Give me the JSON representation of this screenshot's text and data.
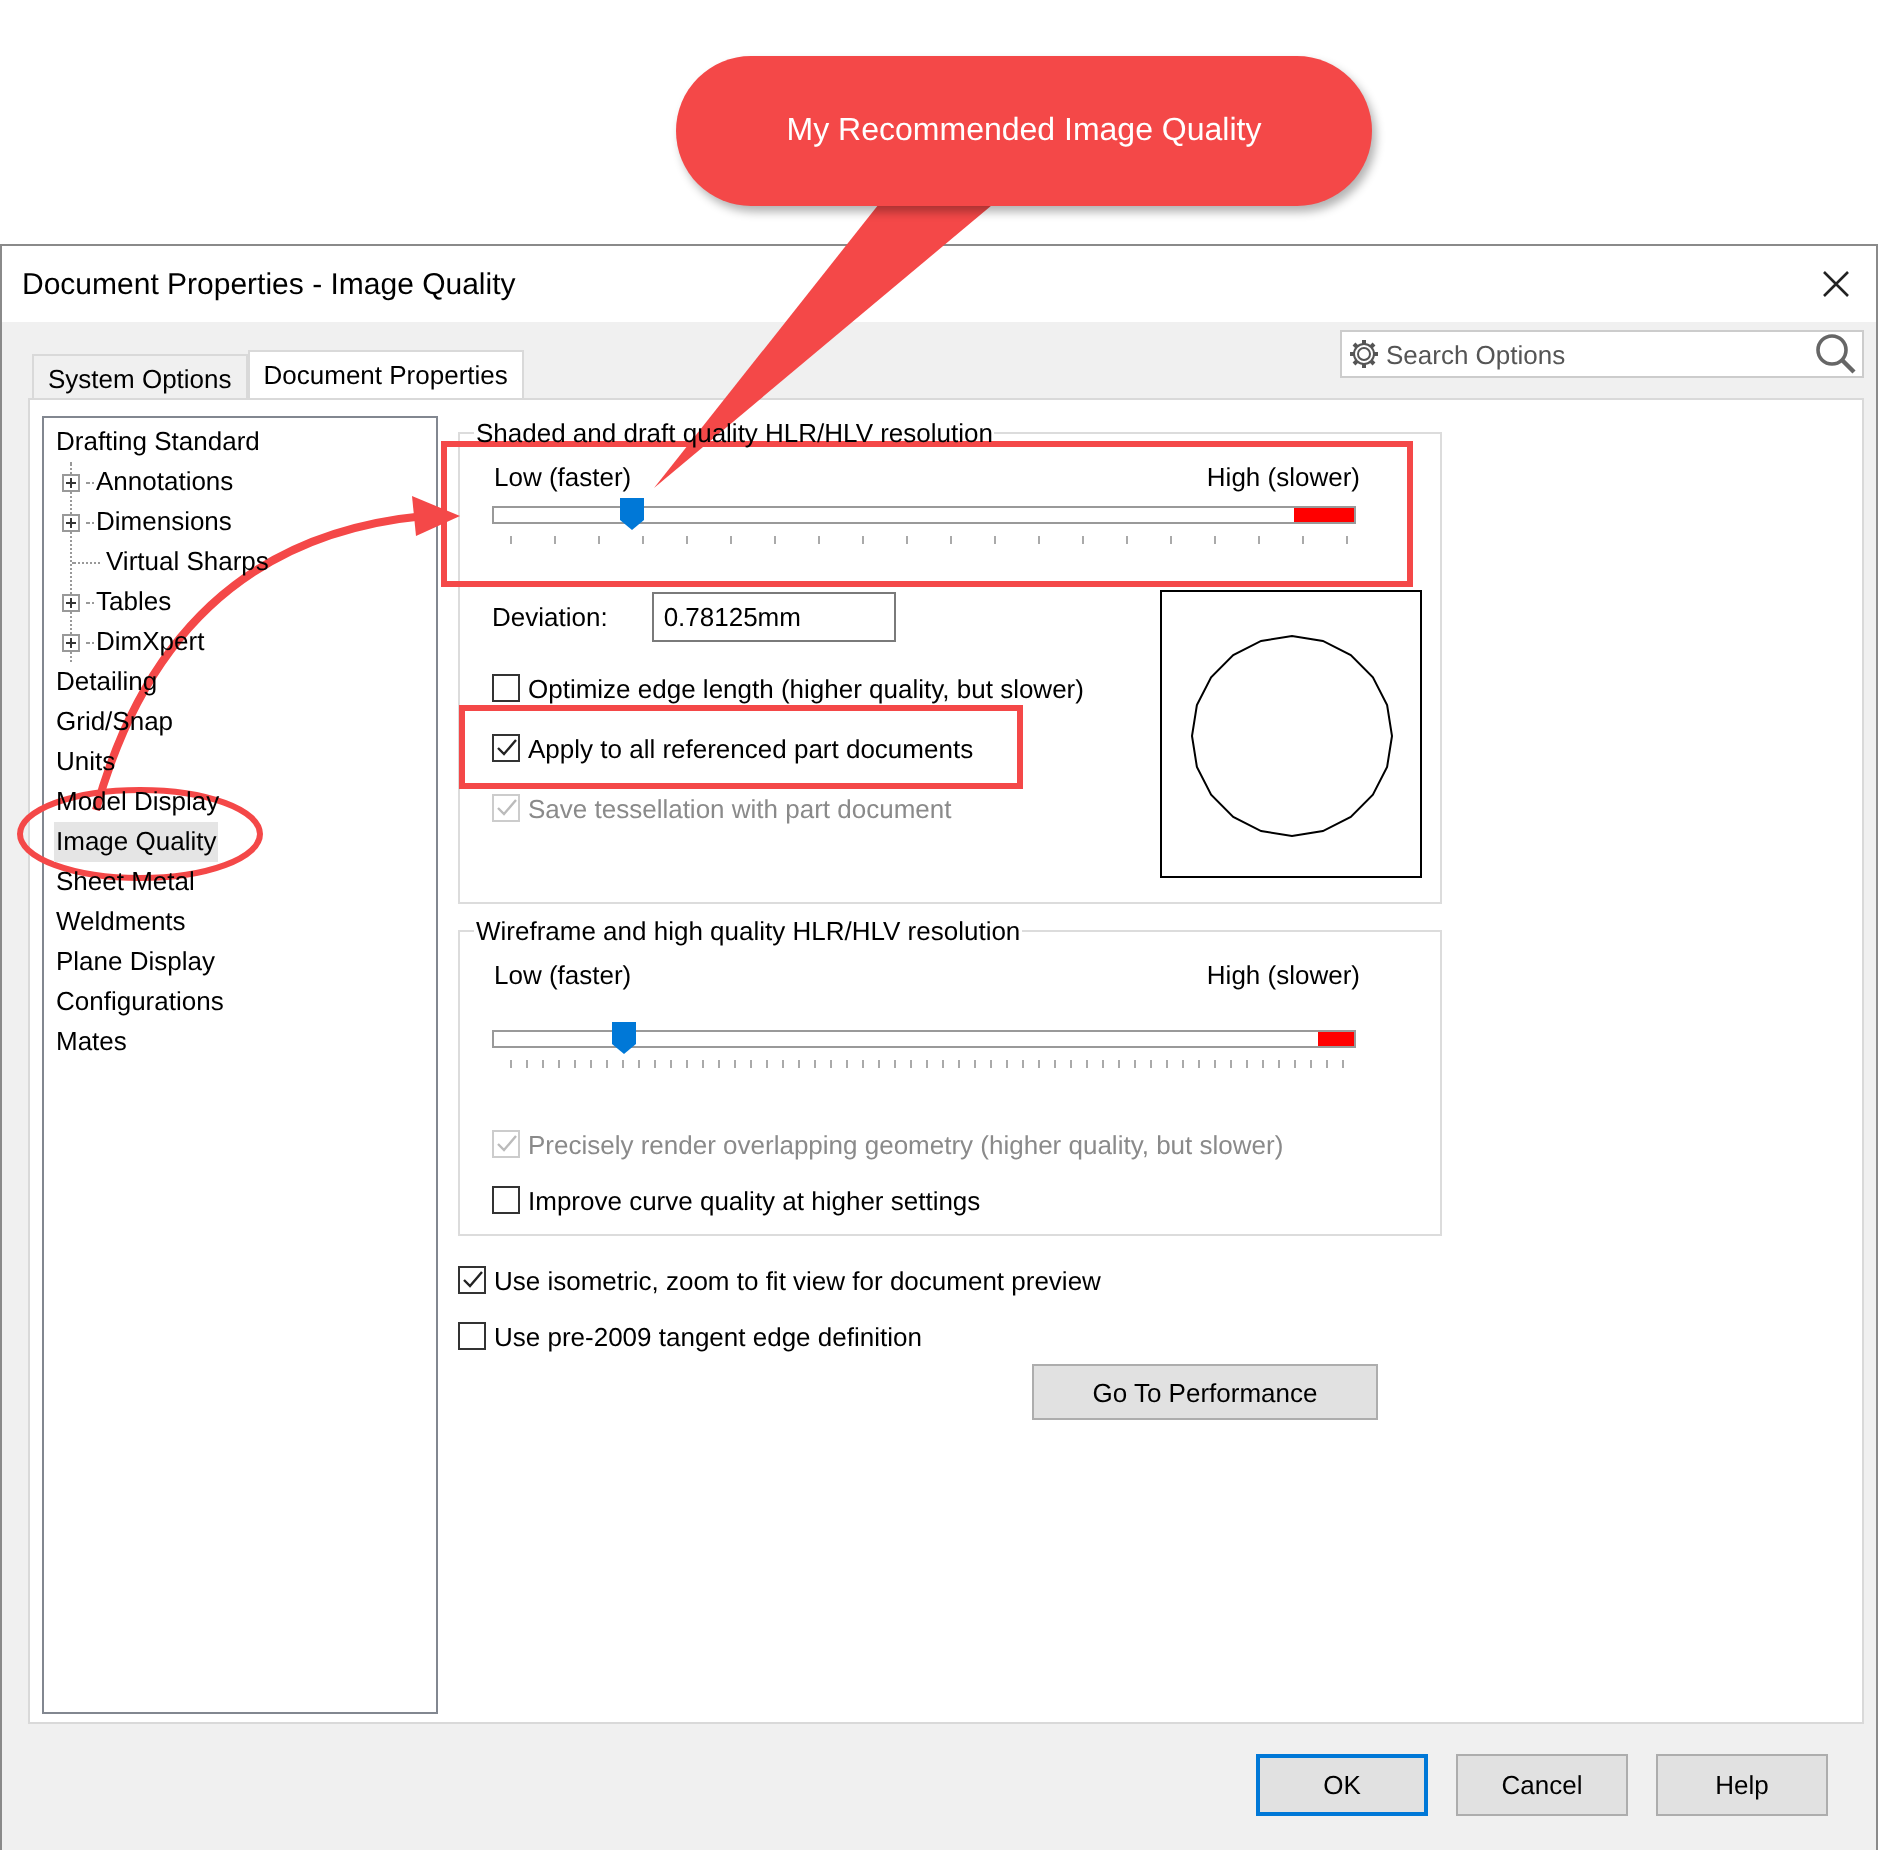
{
  "window": {
    "title": "Document Properties - Image Quality"
  },
  "tabs": [
    {
      "label": "System Options",
      "selected": false
    },
    {
      "label": "Document Properties",
      "selected": true
    }
  ],
  "search": {
    "placeholder": "Search Options"
  },
  "tree": [
    {
      "label": "Drafting Standard",
      "selected": false,
      "children": [
        {
          "label": "Annotations",
          "kind": "group",
          "expanded": false,
          "selected": false
        },
        {
          "label": "Dimensions",
          "kind": "group",
          "expanded": false,
          "selected": false
        },
        {
          "label": "Virtual Sharps",
          "kind": "leaf",
          "selected": false
        },
        {
          "label": "Tables",
          "kind": "group",
          "expanded": false,
          "selected": false
        },
        {
          "label": "DimXpert",
          "kind": "group",
          "expanded": false,
          "selected": false
        }
      ]
    },
    {
      "label": "Detailing",
      "selected": false
    },
    {
      "label": "Grid/Snap",
      "selected": false
    },
    {
      "label": "Units",
      "selected": false
    },
    {
      "label": "Model Display",
      "selected": false
    },
    {
      "label": "Image Quality",
      "selected": true
    },
    {
      "label": "Sheet Metal",
      "selected": false
    },
    {
      "label": "Weldments",
      "selected": false
    },
    {
      "label": "Plane Display",
      "selected": false
    },
    {
      "label": "Configurations",
      "selected": false
    },
    {
      "label": "Mates",
      "selected": false
    }
  ],
  "shaded_group": {
    "title": "Shaded and draft quality HLR/HLV resolution",
    "slider": {
      "low_label": "Low (faster)",
      "high_label": "High (slower)",
      "level": 0.16
    },
    "deviation": {
      "label": "Deviation:",
      "value": "0.78125mm"
    },
    "options": [
      {
        "label": "Optimize edge length (higher quality, but slower)",
        "checked": false,
        "disabled": false
      },
      {
        "label": "Apply to all referenced part documents",
        "checked": true,
        "disabled": false
      },
      {
        "label": "Save tessellation with part document",
        "checked": true,
        "disabled": true
      }
    ]
  },
  "wireframe_group": {
    "title": "Wireframe and high quality HLR/HLV resolution",
    "slider": {
      "low_label": "Low (faster)",
      "high_label": "High (slower)",
      "level": 0.15
    },
    "options": [
      {
        "label": "Precisely render overlapping geometry (higher quality, but slower)",
        "checked": true,
        "disabled": true
      },
      {
        "label": "Improve curve quality at higher settings",
        "checked": false,
        "disabled": false
      }
    ]
  },
  "options": [
    {
      "label": "Use isometric, zoom to fit view for document preview",
      "checked": true,
      "disabled": false
    },
    {
      "label": "Use pre-2009 tangent edge definition",
      "checked": false,
      "disabled": false
    }
  ],
  "performance_button": "Go To Performance",
  "buttons": [
    {
      "label": "OK",
      "default": true
    },
    {
      "label": "Cancel",
      "default": false
    },
    {
      "label": "Help",
      "default": false
    }
  ],
  "callout": "My Recommended Image Quality"
}
